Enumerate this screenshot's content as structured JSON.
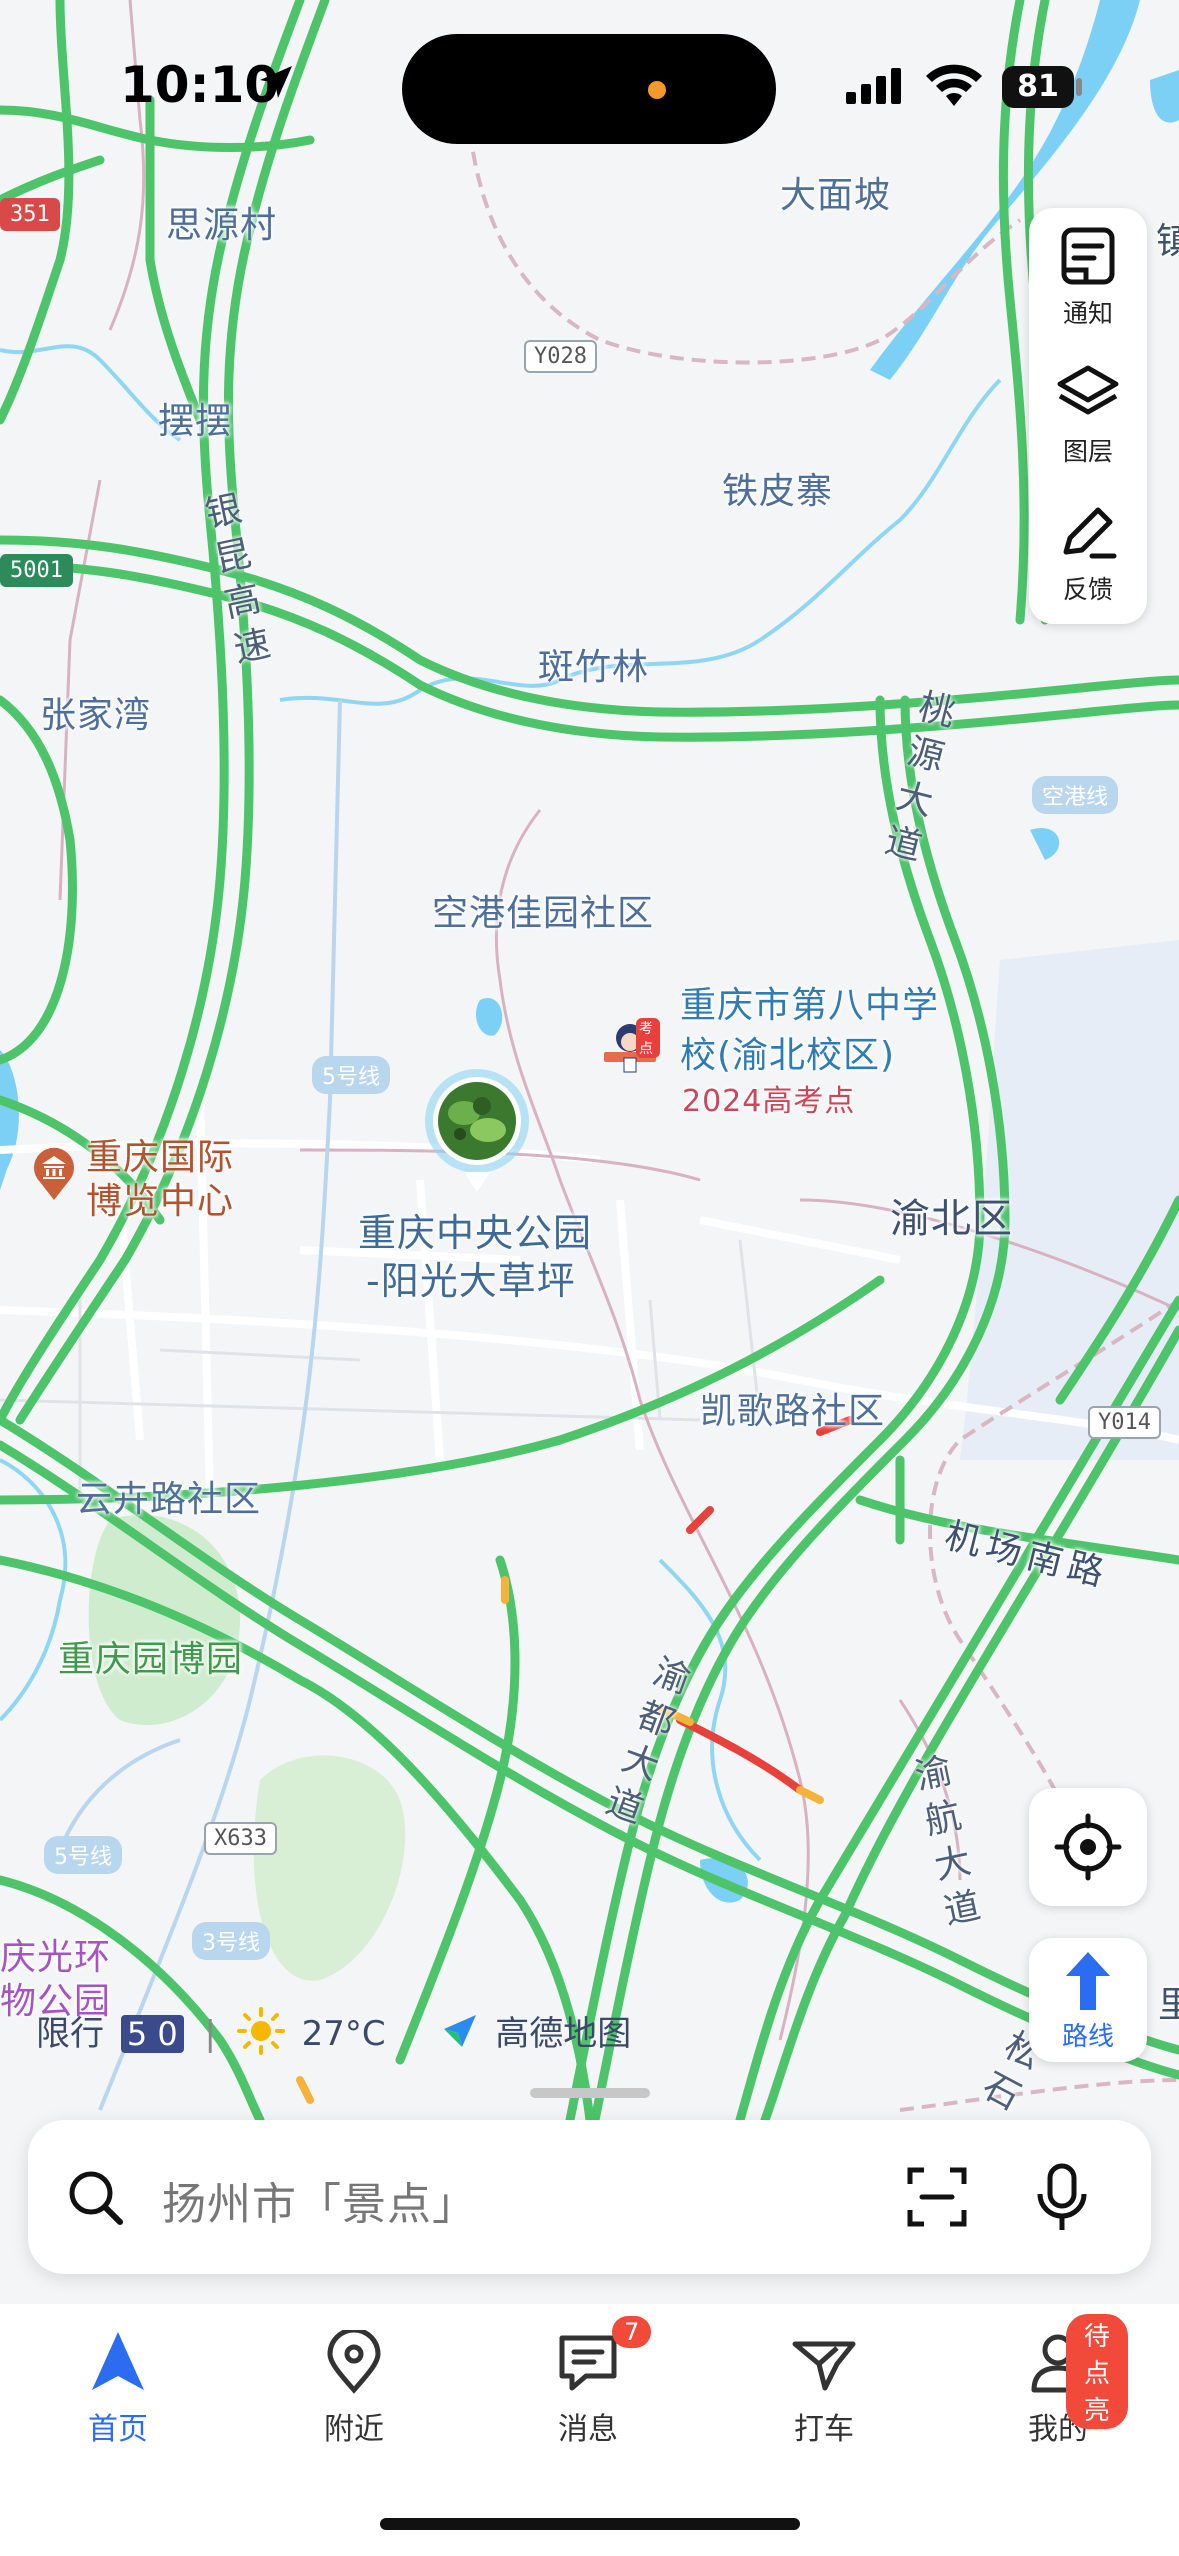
{
  "status_bar": {
    "time": "10:10",
    "battery": "81"
  },
  "map": {
    "labels": {
      "siyuancun": "思源村",
      "baibai": "摆摆",
      "damianpo": "大面坡",
      "tiepizhai": "铁皮寨",
      "banzhulin": "斑竹林",
      "zhangjiawan": "张家湾",
      "konggang": "空港佳园社区",
      "school_line1": "重庆市第八中学",
      "school_line2": "校(渝北校区)",
      "school_tag": "2024高考点",
      "expo_line1": "重庆国际",
      "expo_line2": "博览中心",
      "park_line1": "重庆中央公园",
      "park_line2": "-阳光大草坪",
      "yubeiqu": "渝北区",
      "kaigelu": "凯歌路社区",
      "yunhuilu": "云卉路社区",
      "yuanboyuan": "重庆园博园",
      "huanqiu_line1": "庆光环",
      "huanqiu_line2": "物公园",
      "jichangnanlu": "机场南路",
      "edge_right": "里",
      "edge_right2": "镇"
    },
    "road_vertical": {
      "yinkun": "银昆高速",
      "taoyuan": "桃源大道",
      "yudu": "渝都大道",
      "yuhang": "渝航大道",
      "bottom": "松石"
    },
    "shields": {
      "g351": "351",
      "g5001": "5001",
      "y028": "Y028",
      "y014": "Y014",
      "x633": "X633"
    },
    "metro": {
      "line5a": "5号线",
      "line5b": "5号线",
      "line3": "3号线",
      "konggangxian": "空港线"
    },
    "school_badge": "考点"
  },
  "tools": {
    "notify": "通知",
    "layers": "图层",
    "feedback": "反馈",
    "route": "路线"
  },
  "info_row": {
    "restrict_label": "限行",
    "restrict_plate": "5 0",
    "temperature": "27°C",
    "brand": "高德地图"
  },
  "search": {
    "placeholder": "扬州市「景点」"
  },
  "tabbar": {
    "home": "首页",
    "nearby": "附近",
    "messages": "消息",
    "messages_badge": "7",
    "taxi": "打车",
    "mine": "我的",
    "mine_badge": "待点亮"
  },
  "colors": {
    "road_green": "#4ec46a",
    "accent_blue": "#2b6cf0",
    "water": "#7cd0f5",
    "badge_red": "#f14a3b"
  }
}
